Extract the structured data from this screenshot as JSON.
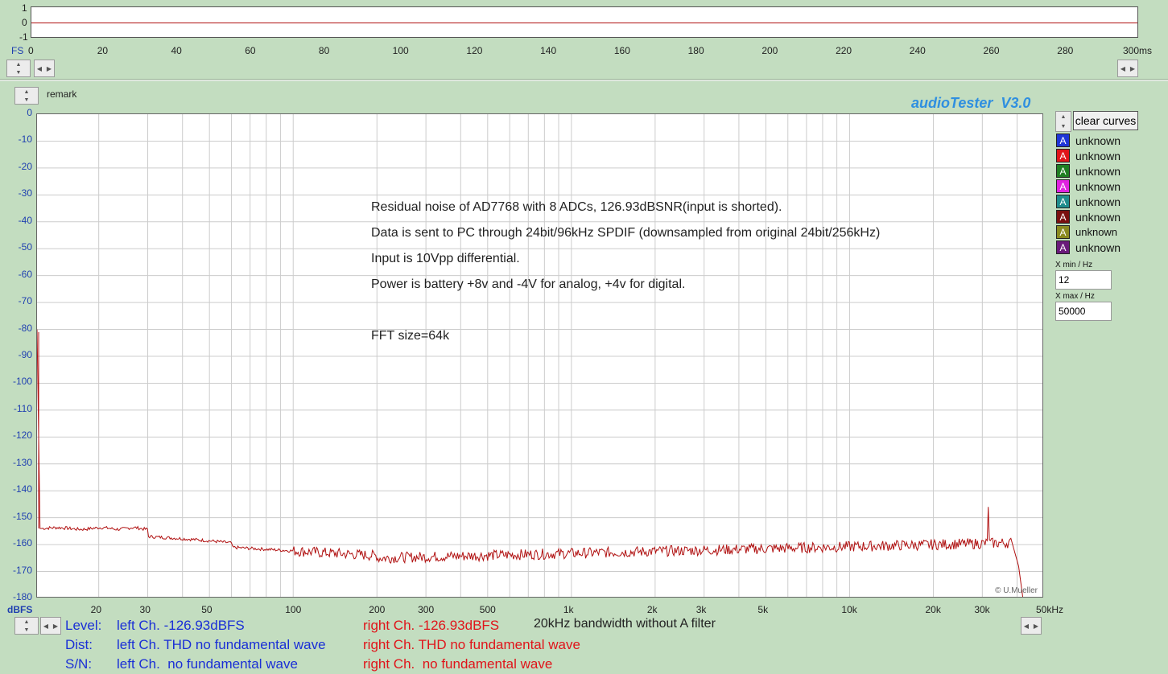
{
  "scope": {
    "y_ticks": [
      "1",
      "0",
      "-1"
    ],
    "unit_label": "FS",
    "x_ticks": [
      "0",
      "20",
      "40",
      "60",
      "80",
      "100",
      "120",
      "140",
      "160",
      "180",
      "200",
      "220",
      "240",
      "260",
      "280"
    ],
    "x_end_label": "300ms"
  },
  "remark_label": "remark",
  "brand": "audioTester  V3.0",
  "clear_button": "clear curves",
  "legend": [
    {
      "color": "#1f35d8",
      "label": "unknown"
    },
    {
      "color": "#e0141a",
      "label": "unknown"
    },
    {
      "color": "#1f7f22",
      "label": "unknown"
    },
    {
      "color": "#e022e0",
      "label": "unknown"
    },
    {
      "color": "#1f8c8c",
      "label": "unknown"
    },
    {
      "color": "#7a1010",
      "label": "unknown"
    },
    {
      "color": "#8a8a20",
      "label": "unknown"
    },
    {
      "color": "#6a1a7a",
      "label": "unknown"
    }
  ],
  "legend_glyph": "A",
  "xmin_label": "X min / Hz",
  "xmin_value": "12",
  "xmax_label": "X max / Hz",
  "xmax_value": "50000",
  "spectrum": {
    "y_ticks": [
      "0",
      "-10",
      "-20",
      "-30",
      "-40",
      "-50",
      "-60",
      "-70",
      "-80",
      "-90",
      "-100",
      "-110",
      "-120",
      "-130",
      "-140",
      "-150",
      "-160",
      "-170",
      "-180"
    ],
    "y_unit": "dBFS",
    "x_ticks": [
      "20",
      "30",
      "50",
      "100",
      "200",
      "300",
      "500",
      "1k",
      "2k",
      "3k",
      "5k",
      "10k",
      "20k",
      "30k",
      "50kHz"
    ],
    "copyright": "© U.Mueller",
    "notes": [
      "Residual noise of AD7768 with 8 ADCs, 126.93dBSNR(input is shorted).",
      "Data is sent to PC through 24bit/96kHz SPDIF (downsampled from original 24bit/256kHz)",
      "Input is 10Vpp differential.",
      "Power is battery +8v and -4V for analog, +4v for digital.",
      "FFT size=64k"
    ]
  },
  "status": {
    "level_label": "Level:",
    "dist_label": "Dist:",
    "sn_label": "S/N:",
    "left_level": "left Ch. -126.93dBFS",
    "right_level": "right Ch. -126.93dBFS",
    "bandwidth": "20kHz bandwidth without A filter",
    "left_dist": "left Ch. THD no fundamental wave",
    "right_dist": "right Ch. THD no fundamental wave",
    "left_sn": "left Ch.  no fundamental wave",
    "right_sn": "right Ch.  no fundamental wave"
  },
  "colors": {
    "trace": "#b01010",
    "axis_text": "#1f3fb0",
    "brand": "#2f8fe0",
    "grid": "#cccccc"
  }
}
